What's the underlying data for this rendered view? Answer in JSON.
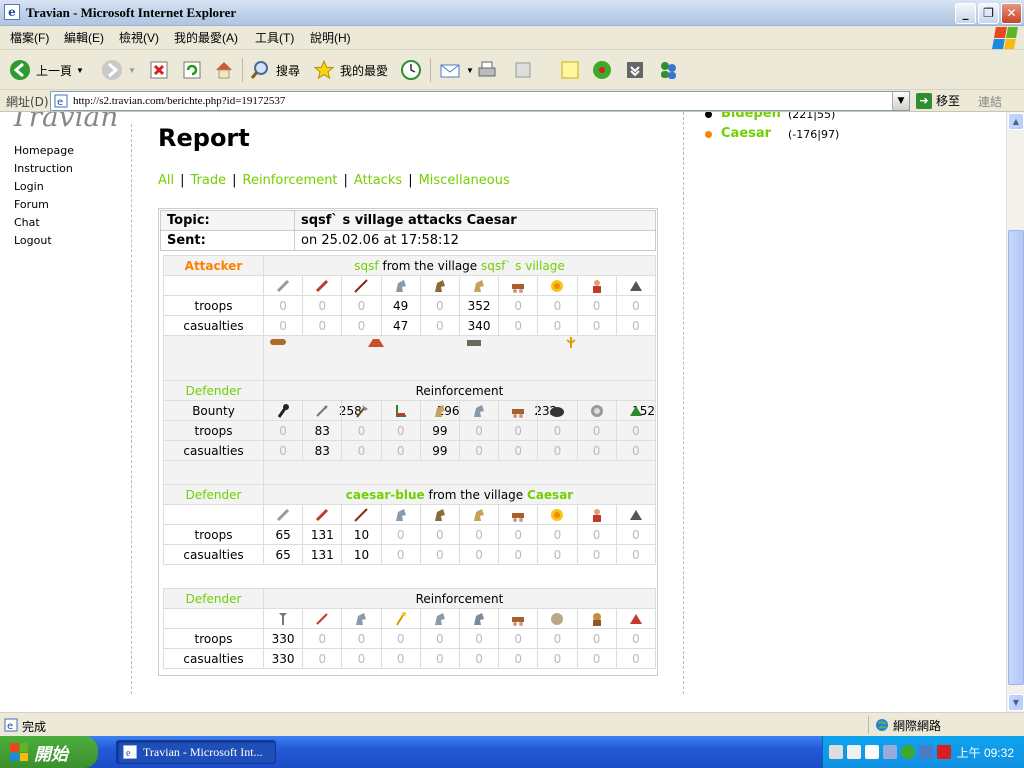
{
  "window": {
    "title": "Travian - Microsoft Internet Explorer",
    "min": "_",
    "max": "❐",
    "close": "✕"
  },
  "menubar": [
    "檔案(F)",
    "編輯(E)",
    "檢視(V)",
    "我的最愛(A)",
    "工具(T)",
    "說明(H)"
  ],
  "toolbar": {
    "back": "上一頁",
    "search": "搜尋",
    "favorites": "我的最愛"
  },
  "address": {
    "label": "網址(D)",
    "url": "http://s2.travian.com/berichte.php?id=19172537",
    "go": "移至",
    "links": "連結"
  },
  "nav": [
    "Homepage",
    "Instruction",
    "Login",
    "Forum",
    "Chat",
    "Logout"
  ],
  "villages": [
    {
      "name": "Bidepen",
      "coords": "(221|55)",
      "bullet": "#000000"
    },
    {
      "name": "Caesar",
      "coords": "(-176|97)",
      "bullet": "#ff8000"
    }
  ],
  "report": {
    "heading": "Report",
    "tabs": [
      "All",
      "Trade",
      "Reinforcement",
      "Attacks",
      "Miscellaneous"
    ],
    "topic_label": "Topic:",
    "topic": "sqsf` s village attacks Caesar",
    "sent_label": "Sent:",
    "sent": "on 25.02.06 at 17:58:12"
  },
  "row_labels": {
    "troops": "troops",
    "casualties": "casualties",
    "bounty": "Bounty",
    "from": "from the village"
  },
  "attacker": {
    "role": "Attacker",
    "player": "sqsf",
    "village": "sqsf` s village",
    "troops": [
      "0",
      "0",
      "0",
      "49",
      "0",
      "352",
      "0",
      "0",
      "0",
      "0"
    ],
    "casualties": [
      "0",
      "0",
      "0",
      "47",
      "0",
      "340",
      "0",
      "0",
      "0",
      "0"
    ],
    "bounty": [
      "258",
      "196",
      "232",
      "152"
    ]
  },
  "defender1": {
    "role": "Defender",
    "label": "Reinforcement",
    "troops": [
      "0",
      "83",
      "0",
      "0",
      "99",
      "0",
      "0",
      "0",
      "0",
      "0"
    ],
    "casualties": [
      "0",
      "83",
      "0",
      "0",
      "99",
      "0",
      "0",
      "0",
      "0",
      "0"
    ]
  },
  "defender2": {
    "role": "Defender",
    "player": "caesar-blue",
    "village": "Caesar",
    "troops": [
      "65",
      "131",
      "10",
      "0",
      "0",
      "0",
      "0",
      "0",
      "0",
      "0"
    ],
    "casualties": [
      "65",
      "131",
      "10",
      "0",
      "0",
      "0",
      "0",
      "0",
      "0",
      "0"
    ]
  },
  "defender3": {
    "role": "Defender",
    "label": "Reinforcement",
    "troops": [
      "330",
      "0",
      "0",
      "0",
      "0",
      "0",
      "0",
      "0",
      "0",
      "0"
    ],
    "casualties": [
      "330",
      "0",
      "0",
      "0",
      "0",
      "0",
      "0",
      "0",
      "0",
      "0"
    ]
  },
  "status": {
    "text": "完成",
    "zone": "網際網路"
  },
  "taskbar": {
    "start": "開始",
    "item": "Travian - Microsoft Int...",
    "clock": "上午 09:32"
  },
  "colors": {
    "link_green": "#71d000",
    "attacker_orange": "#ff8000",
    "taskbar_blue": "#2459d6",
    "start_green": "#3b8f2e"
  }
}
